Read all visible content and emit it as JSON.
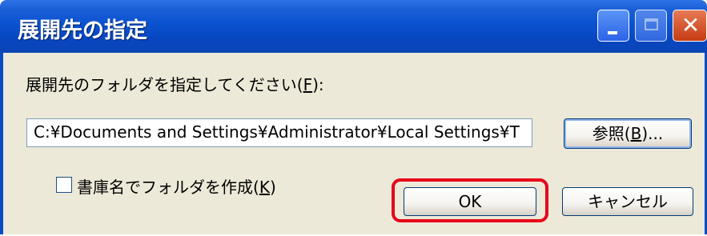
{
  "window": {
    "title": "展開先の指定",
    "controls": {
      "minimize_icon": "minimize-icon",
      "maximize_icon": "maximize-icon",
      "close_icon": "close-icon",
      "close_glyph": "✕"
    }
  },
  "dialog": {
    "prompt_text": "展開先のフォルダを指定してください(",
    "prompt_accel": "F",
    "prompt_end": "):",
    "path_value": "C:¥Documents and Settings¥Administrator¥Local Settings¥T",
    "browse_text": "参照(",
    "browse_accel": "B",
    "browse_end": ")...",
    "checkbox_text": "書庫名でフォルダを作成(",
    "checkbox_accel": "K",
    "checkbox_end": ")",
    "checkbox_checked": false,
    "ok_label": "OK",
    "cancel_label": "キャンセル",
    "highlight_color": "#e6001a"
  }
}
